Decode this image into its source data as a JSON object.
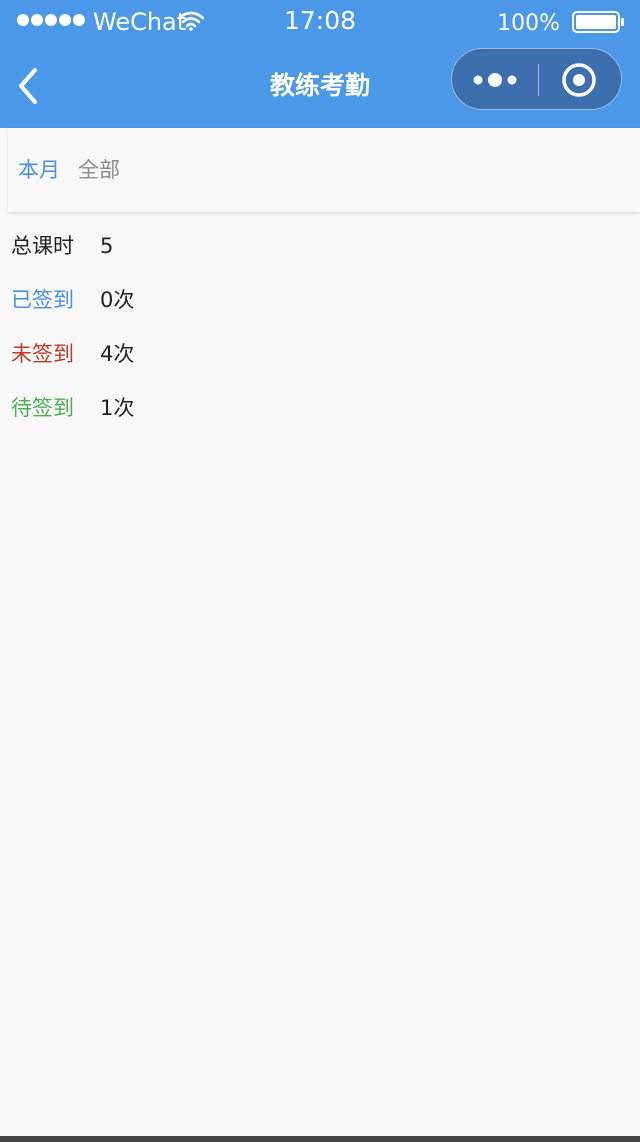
{
  "status_bar": {
    "carrier": "WeChat",
    "time": "17:08",
    "battery": "100%"
  },
  "nav": {
    "title": "教练考勤"
  },
  "tabs": [
    {
      "label": "本月",
      "active": true
    },
    {
      "label": "全部",
      "active": false
    }
  ],
  "stats": [
    {
      "label": "总课时",
      "value": "5",
      "color": "#222222"
    },
    {
      "label": "已签到",
      "value": "0次",
      "color": "#4a90e2"
    },
    {
      "label": "未签到",
      "value": "4次",
      "color": "#c0392b"
    },
    {
      "label": "待签到",
      "value": "1次",
      "color": "#4caf50"
    }
  ],
  "colors": {
    "header_bg": "#4b97e8",
    "active_tab": "#4a90e2",
    "inactive_tab": "#8a8a8a",
    "page_bg": "#f8f8f8"
  },
  "icons": {
    "signal": "signal-dots-icon",
    "wifi": "wifi-icon",
    "battery": "battery-icon",
    "back": "chevron-left-icon",
    "menu": "more-dots-icon",
    "close": "target-circle-icon"
  }
}
